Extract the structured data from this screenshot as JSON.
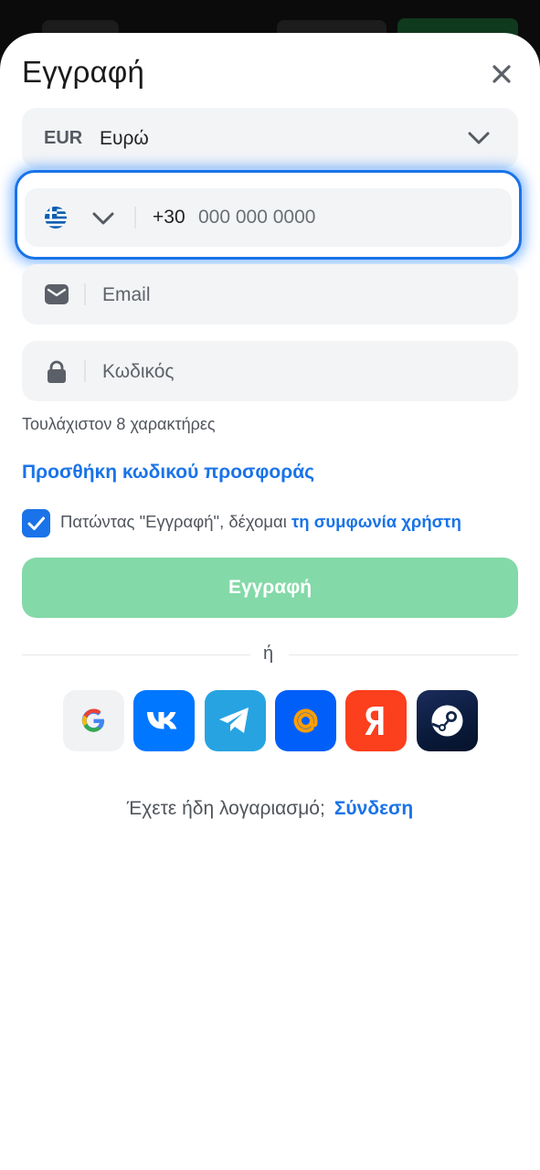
{
  "title": "Εγγραφή",
  "currency": {
    "code": "EUR",
    "name": "Ευρώ"
  },
  "phone": {
    "country_flag": "greece-flag-icon",
    "prefix": "+30",
    "placeholder": "000 000 0000"
  },
  "email": {
    "placeholder": "Email"
  },
  "password": {
    "placeholder": "Κωδικός",
    "hint": "Τουλάχιστον 8 χαρακτήρες"
  },
  "promo_link": "Προσθήκη κωδικού προσφοράς",
  "agreement": {
    "checked": true,
    "text": "Πατώντας \"Εγγραφή\", δέχομαι",
    "link": "τη συμφωνία χρήστη"
  },
  "submit_label": "Εγγραφή",
  "divider_text": "ή",
  "social": [
    {
      "name": "google",
      "icon": "google-icon"
    },
    {
      "name": "vk",
      "icon": "vk-icon"
    },
    {
      "name": "telegram",
      "icon": "telegram-icon"
    },
    {
      "name": "mailru",
      "icon": "mail-at-icon"
    },
    {
      "name": "yandex",
      "icon": "yandex-icon"
    },
    {
      "name": "steam",
      "icon": "steam-icon"
    }
  ],
  "footer": {
    "text": "Έχετε ήδη λογαριασμό;",
    "login_link": "Σύνδεση"
  },
  "colors": {
    "accent": "#1a73e8",
    "submit_disabled": "#83d9a8",
    "field_bg": "#f3f4f6"
  }
}
